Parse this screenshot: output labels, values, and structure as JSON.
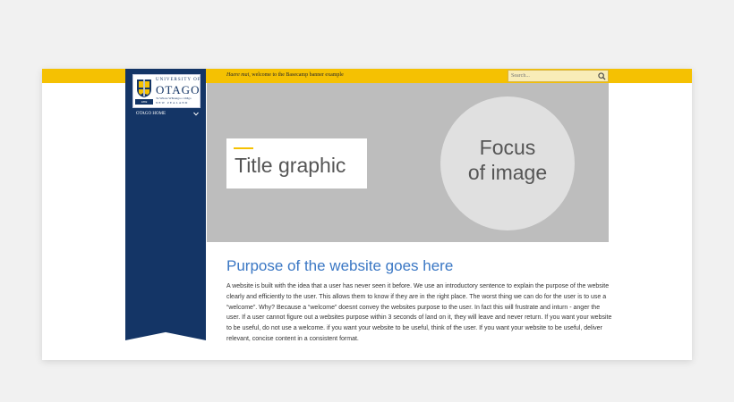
{
  "topbar": {
    "welcome_italic": "Haere mai",
    "welcome_rest": ", welcome to the Basecamp banner example",
    "search_placeholder": "Search...",
    "search_icon": "search-icon"
  },
  "sidebar": {
    "logo": {
      "university": "UNIVERSITY",
      "of": "OF",
      "name": "OTAGO",
      "maori": "Te Whare Wānanga o Otāgo",
      "country": "NEW ZEALAND",
      "since": "1869"
    },
    "home_link": "OTAGO HOME",
    "home_icon": "chevron-down-icon"
  },
  "banner": {
    "title": "Title graphic",
    "focus_line1": "Focus",
    "focus_line2": "of image"
  },
  "content": {
    "heading": "Purpose of the website goes here",
    "paragraph": "A website is built with the idea that a user has never seen it before. We use an introductory sentence to explain the purpose of the website clearly and efficiently to the user. This allows them to know if they are in the right place. The worst thing we can do for the user is to use a “welcome”. Why? Because a “welcome” doesnt convey the websites purpose to the user. In fact this will frustrate and inturn - anger the user. If a user cannot figure out a websites purpose within 3 seconds of land on it, they will leave and never return. If you want your website to be useful, do not use a welcome. if you want your website to be useful, think of the user. If you want your website to be useful, deliver relevant, concise content in a consistent format."
  },
  "colors": {
    "topbar": "#f5c102",
    "ribbon": "#143566",
    "banner": "#bdbdbd",
    "heading": "#3a77c4"
  }
}
